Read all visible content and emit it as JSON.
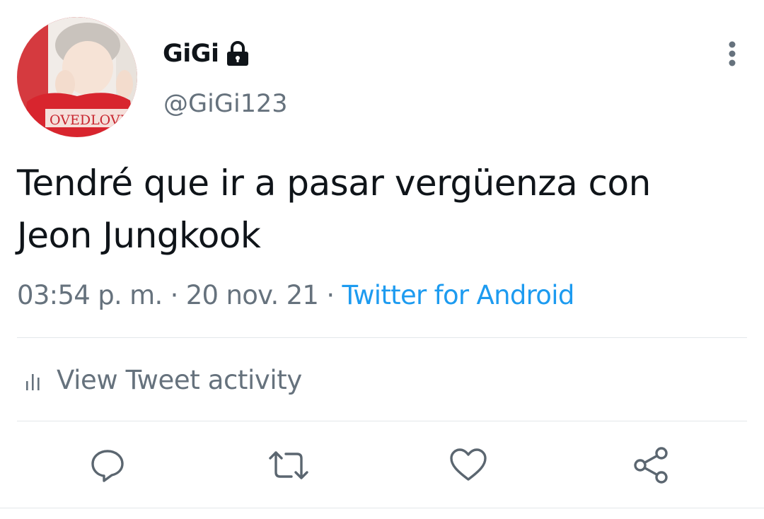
{
  "author": {
    "display_name": "GiGi",
    "handle": "@GiGi123",
    "avatar_text": "OVEDLOVE",
    "protected_icon": "lock-icon"
  },
  "tweet": {
    "text_line1": "Tendré que ir a pasar vergüenza con",
    "text_line2": "Jeon Jungkook",
    "time": "03:54 p. m.",
    "separator": " · ",
    "date": "20 nov. 21",
    "source": "Twitter for Android"
  },
  "activity": {
    "label": "View Tweet activity",
    "icon": "bar-chart-icon"
  },
  "actions": {
    "reply_icon": "reply-icon",
    "retweet_icon": "retweet-icon",
    "like_icon": "heart-icon",
    "share_icon": "share-icon"
  },
  "menu_icon": "more-vertical-icon",
  "colors": {
    "text": "#0f1419",
    "secondary": "#66727d",
    "link": "#1d9bf0",
    "divider": "#e3e7ea",
    "icon": "#5b6670"
  }
}
